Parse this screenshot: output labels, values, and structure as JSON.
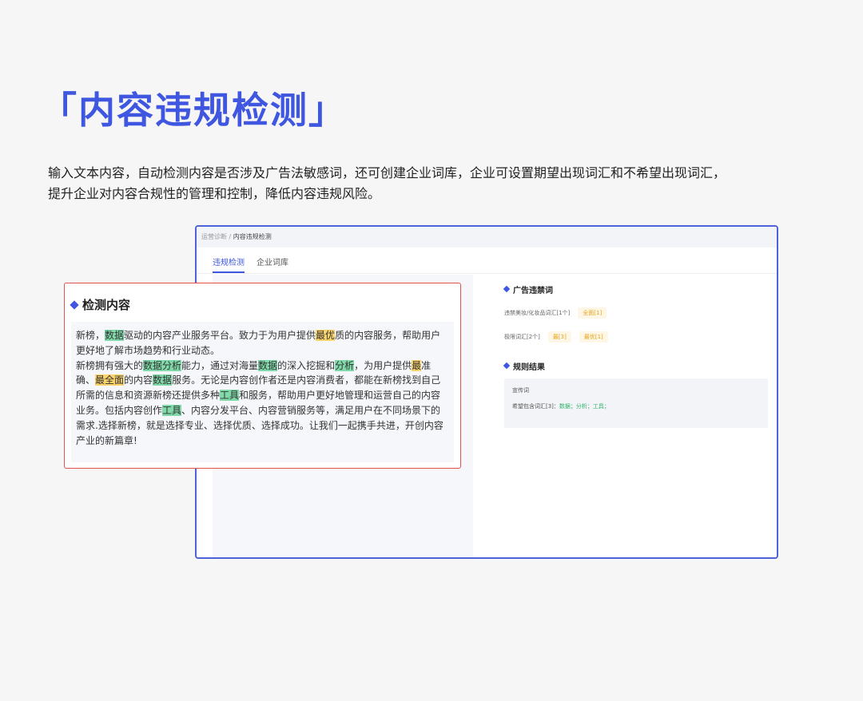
{
  "hero": {
    "title": "「内容违规检测」",
    "desc_line1": "输入文本内容，自动检测内容是否涉及广告法敏感词，还可创建企业词库，企业可设置期望出现词汇和不希望出现词汇，",
    "desc_line2": "提升企业对内容合规性的管理和控制，降低内容违规风险。"
  },
  "window": {
    "breadcrumb_parent": "运营诊断",
    "breadcrumb_sep": "/",
    "breadcrumb_current": "内容违规检测",
    "tabs": [
      {
        "label": "违规检测",
        "active": true
      },
      {
        "label": "企业词库",
        "active": false
      }
    ],
    "ad_section_title": "广告违禁词",
    "ad_rows": [
      {
        "label": "违禁美妆/化妆品词汇[1个]",
        "tags": [
          "全面[1]"
        ]
      },
      {
        "label": "极限词汇[2个]",
        "tags": [
          "最[3]",
          "最优[1]"
        ]
      }
    ],
    "rule_section_title": "规则结果",
    "rule_box": {
      "line1": "宣传词",
      "line2_prefix": "希望包含词汇[3]：",
      "line2_words": "数据；分析；工具；"
    }
  },
  "popup": {
    "title": "检测内容",
    "segments": [
      {
        "t": "新榜，"
      },
      {
        "t": "数据",
        "hl": "g"
      },
      {
        "t": "驱动的内容产业服务平台。致力于为用户提供"
      },
      {
        "t": "最优",
        "hl": "y"
      },
      {
        "t": "质的内容服务，帮助用户更好地了解市场趋势和行业动态。"
      },
      {
        "br": true
      },
      {
        "t": "新榜拥有强大的"
      },
      {
        "t": "数据分析",
        "hl": "g"
      },
      {
        "t": "能力，通过对海量"
      },
      {
        "t": "数据",
        "hl": "g"
      },
      {
        "t": "的深入挖掘和"
      },
      {
        "t": "分析",
        "hl": "g"
      },
      {
        "t": "，为用户提供"
      },
      {
        "t": "最",
        "hl": "y"
      },
      {
        "t": "准确、"
      },
      {
        "t": "最全面",
        "hl": "y"
      },
      {
        "t": "的内容"
      },
      {
        "t": "数据",
        "hl": "g"
      },
      {
        "t": "服务。无论是内容创作者还是内容消费者，都能在新榜找到自己所需的信息和资源新榜还提供多种"
      },
      {
        "t": "工具",
        "hl": "g"
      },
      {
        "t": "和服务，帮助用户更好地管理和运营自己的内容业务。包括内容创作"
      },
      {
        "t": "工具",
        "hl": "g"
      },
      {
        "t": "、内容分发平台、内容营销服务等，满足用户在不同场景下的需求.选择新榜，就是选择专业、选择优质、选择成功。让我们一起携手共进，开创内容产业的新篇章!"
      }
    ]
  },
  "colors": {
    "accent": "#3f57e0",
    "highlight_green": "#7fd9a8",
    "highlight_yellow": "#fbd36b",
    "popup_border": "#e25050"
  }
}
